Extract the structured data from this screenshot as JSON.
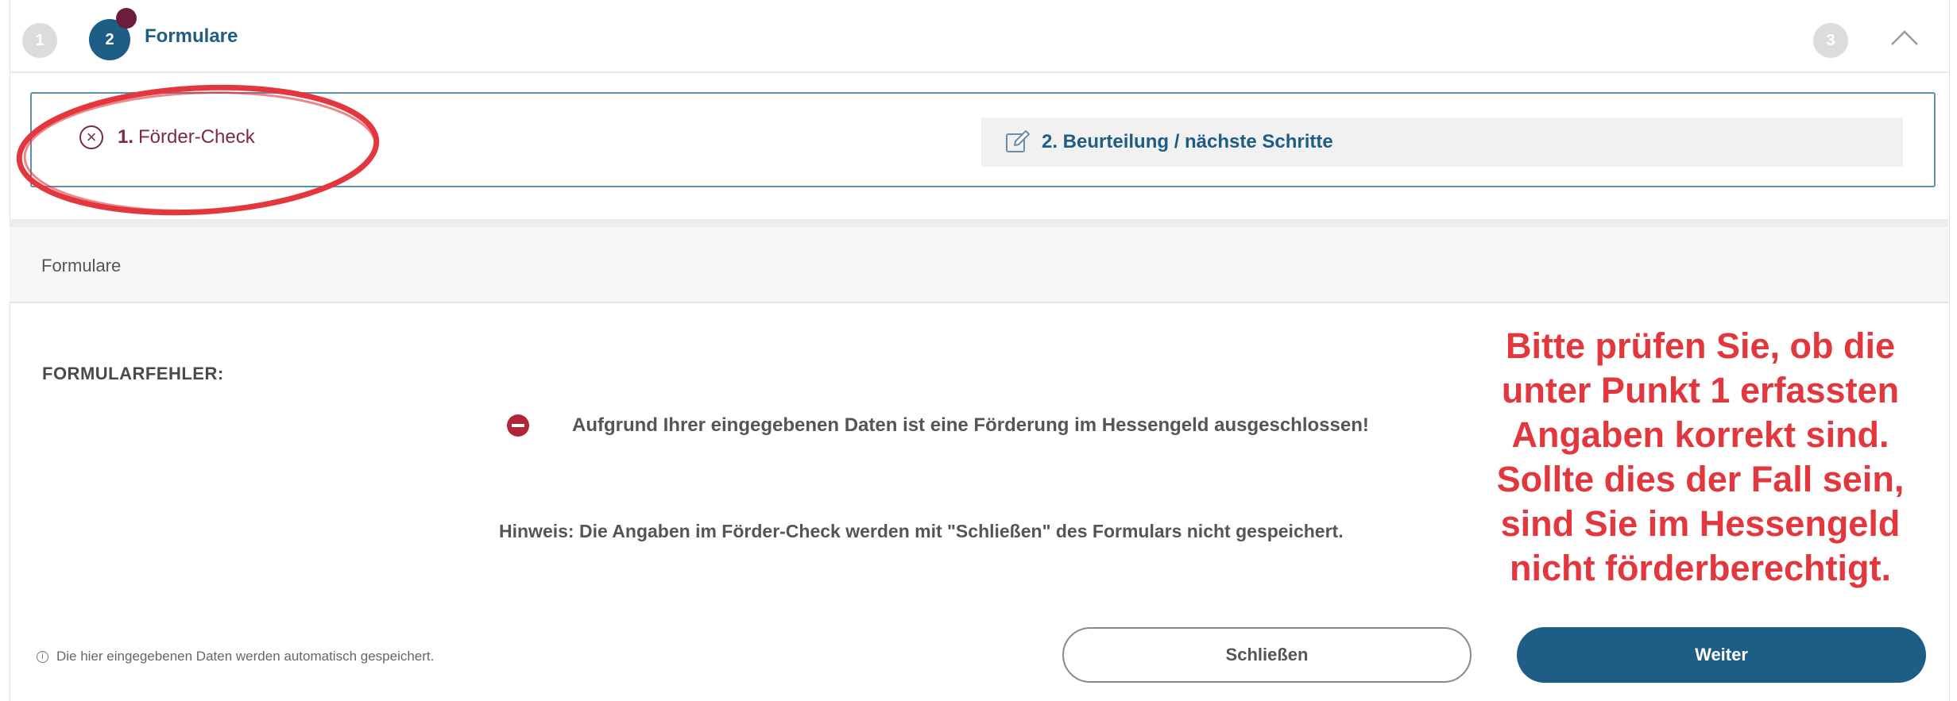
{
  "stepper": {
    "step1": "1",
    "step2": "2",
    "step2_label": "Formulare",
    "step3": "3"
  },
  "tabs": {
    "tab1_number": "1.",
    "tab1_label": "Förder-Check",
    "tab2_label": "2. Beurteilung / nächste Schritte"
  },
  "section": {
    "title": "Formulare"
  },
  "form": {
    "error_heading": "FORMULARFEHLER:",
    "error_message": "Aufgrund Ihrer eingegebenen Daten ist eine Förderung im Hessengeld ausgeschlossen!",
    "hint": "Hinweis: Die Angaben im Förder-Check werden mit \"Schließen\" des Formulars nicht gespeichert."
  },
  "annotation": {
    "line1": "Bitte prüfen Sie, ob die",
    "line2": "unter Punkt 1 erfassten",
    "line3": "Angaben korrekt sind.",
    "line4": "Sollte dies der Fall sein,",
    "line5": "sind Sie im Hessengeld",
    "line6": "nicht förderberechtigt."
  },
  "footer": {
    "autosave_note": "Die hier eingegebenen Daten werden automatisch gespeichert.",
    "close_label": "Schließen",
    "next_label": "Weiter"
  },
  "colors": {
    "primary": "#1e5d86",
    "error_tab": "#7a2a48",
    "annotation": "#e3373e",
    "highlight_ellipse": "#e3373e"
  },
  "icons": {
    "tab1": "circle-x-icon",
    "tab2": "edit-pencil-icon",
    "error": "no-entry-icon",
    "footer": "info-icon",
    "collapse": "chevron-up-icon"
  }
}
